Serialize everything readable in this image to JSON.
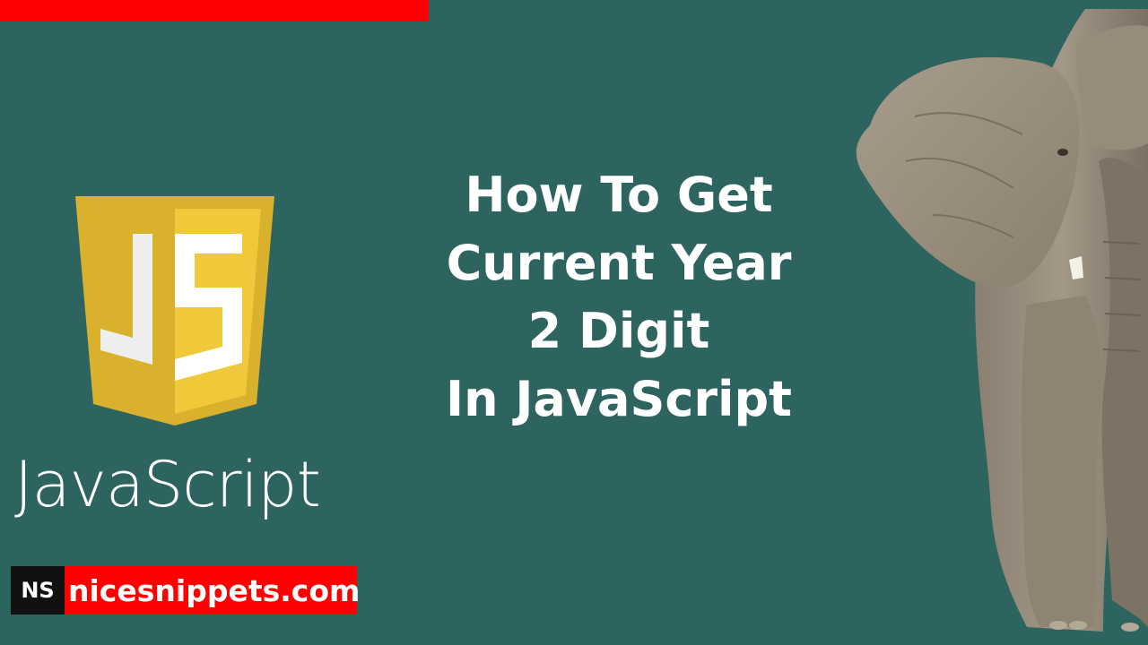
{
  "headline": {
    "line1": "How To Get",
    "line2": "Current Year",
    "line3": "2 Digit",
    "line4": "In JavaScript"
  },
  "logo": {
    "shield_text": "JS",
    "wordmark": "JavaScript"
  },
  "brand": {
    "abbrev": "NS",
    "site": "nicesnippets.com"
  },
  "colors": {
    "background": "#2d6460",
    "accent_red": "#ff0000",
    "shield_yellow": "#e9bf2b",
    "badge_black": "#111111"
  }
}
